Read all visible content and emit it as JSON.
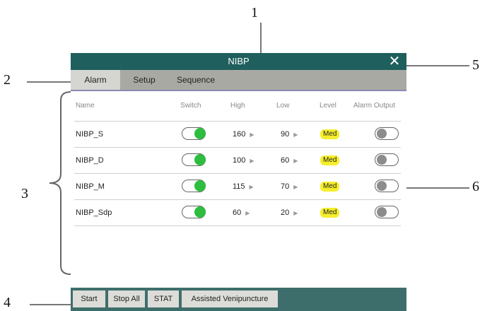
{
  "callouts": [
    "1",
    "2",
    "3",
    "4",
    "5",
    "6"
  ],
  "window": {
    "title": "NIBP",
    "close_glyph": "✕"
  },
  "tabs": [
    {
      "label": "Alarm",
      "active": true
    },
    {
      "label": "Setup",
      "active": false
    },
    {
      "label": "Sequence",
      "active": false
    }
  ],
  "table": {
    "headers": {
      "name": "Name",
      "switch": "Switch",
      "high": "High",
      "low": "Low",
      "level": "Level",
      "alarm_output": "Alarm Output"
    },
    "rows": [
      {
        "name": "NIBP_S",
        "switch_on": true,
        "high": "160",
        "low": "90",
        "level": "Med",
        "alarm_output_on": false
      },
      {
        "name": "NIBP_D",
        "switch_on": true,
        "high": "100",
        "low": "60",
        "level": "Med",
        "alarm_output_on": false
      },
      {
        "name": "NIBP_M",
        "switch_on": true,
        "high": "115",
        "low": "70",
        "level": "Med",
        "alarm_output_on": false
      },
      {
        "name": "NIBP_Sdp",
        "switch_on": true,
        "high": "60",
        "low": "20",
        "level": "Med",
        "alarm_output_on": false
      }
    ]
  },
  "bottom_buttons": [
    "Start",
    "Stop All",
    "STAT",
    "Assisted Venipuncture"
  ],
  "colors": {
    "titlebar": "#1f5f5d",
    "bottombar": "#3e6e6b",
    "switch_on": "#2ebd3f",
    "switch_off": "#8c8c8c",
    "level_badge": "#f5ee2a"
  },
  "icons": {
    "close": "close-icon",
    "arrow": "triangle-right-icon"
  }
}
